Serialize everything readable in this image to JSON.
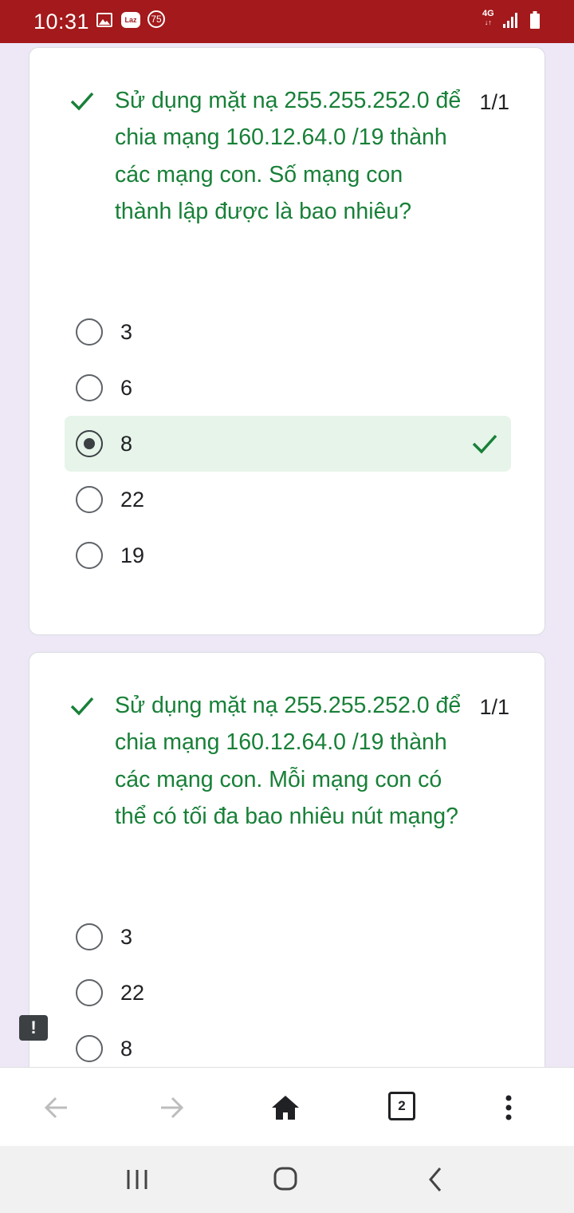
{
  "status_bar": {
    "time": "10:31",
    "laz_label": "Laz",
    "badge": "75",
    "network": "4G"
  },
  "questions": [
    {
      "text": "Sử dụng mặt nạ 255.255.252.0 để chia mạng 160.12.64.0 /19 thành các mạng con. Số mạng con thành lập được là bao nhiêu?",
      "score": "1/1",
      "options": [
        "3",
        "6",
        "8",
        "22",
        "19"
      ],
      "selected": "8"
    },
    {
      "text": "Sử dụng mặt nạ 255.255.252.0 để chia mạng 160.12.64.0 /19 thành các mạng con. Mỗi mạng con có thể có tối đa bao nhiêu nút mạng?",
      "score": "1/1",
      "options": [
        "3",
        "22",
        "8"
      ]
    }
  ],
  "toolbar": {
    "tab_count": "2"
  },
  "report_label": "!",
  "colors": {
    "status_bar": "#a4191b",
    "correct_green": "#188038",
    "selected_bg": "#e6f4ea",
    "page_bg": "#ede7f6"
  }
}
